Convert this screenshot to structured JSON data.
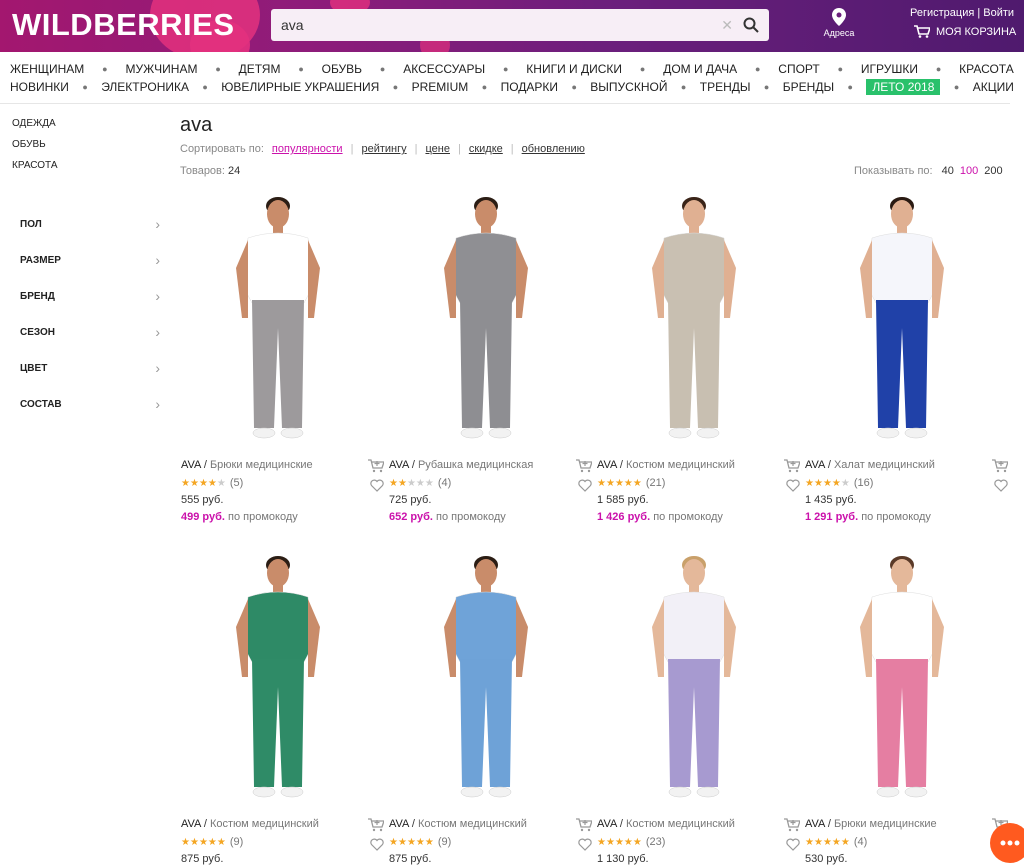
{
  "header": {
    "logo": "WILDBERRIES",
    "search_value": "ava",
    "addresses": "Адреса",
    "register": "Регистрация",
    "login": "Войти",
    "cart": "МОЯ КОРЗИНА",
    "colors": {
      "primary": "#8e1c7a",
      "accent": "#cb11ab",
      "green": "#29c16b"
    }
  },
  "nav": {
    "row1": [
      "ЖЕНЩИНАМ",
      "МУЖЧИНАМ",
      "ДЕТЯМ",
      "ОБУВЬ",
      "АКСЕССУАРЫ",
      "КНИГИ И ДИСКИ",
      "ДОМ И ДАЧА",
      "СПОРТ",
      "ИГРУШКИ",
      "КРАСОТА"
    ],
    "row2": [
      "НОВИНКИ",
      "ЭЛЕКТРОНИКА",
      "ЮВЕЛИРНЫЕ УКРАШЕНИЯ",
      "PREMIUM",
      "ПОДАРКИ",
      "ВЫПУСКНОЙ",
      "ТРЕНДЫ",
      "БРЕНДЫ",
      "ЛЕТО 2018",
      "АКЦИИ"
    ]
  },
  "sidebar": {
    "categories": [
      "ОДЕЖДА",
      "ОБУВЬ",
      "КРАСОТА"
    ],
    "filters": [
      "ПОЛ",
      "РАЗМЕР",
      "БРЕНД",
      "СЕЗОН",
      "ЦВЕТ",
      "СОСТАВ"
    ]
  },
  "main": {
    "title": "ava",
    "sort_label": "Сортировать по:",
    "sort_options": [
      "популярности",
      "рейтингу",
      "цене",
      "скидке",
      "обновлению"
    ],
    "count_label": "Товаров:",
    "count": "24",
    "perpage_label": "Показывать по:",
    "perpage_options": [
      "40",
      "100",
      "200"
    ],
    "promo_suffix": "по промокоду"
  },
  "products": [
    {
      "brand": "AVA",
      "name": "Брюки медицинские",
      "rating": 4,
      "reviews": "(5)",
      "price": "555 руб.",
      "promo": "499 руб.",
      "figure": {
        "top": "#ffffff",
        "bottom": "#9d9a9c",
        "skin": "#c98c6a",
        "hair": "#2b1d14"
      }
    },
    {
      "brand": "AVA",
      "name": "Рубашка медицинская",
      "rating": 2,
      "reviews": "(4)",
      "price": "725 руб.",
      "promo": "652 руб.",
      "figure": {
        "top": "#8f8f93",
        "bottom": "#8e8e92",
        "skin": "#c98c6a",
        "hair": "#2b1d14"
      }
    },
    {
      "brand": "AVA",
      "name": "Костюм медицинский",
      "rating": 5,
      "reviews": "(21)",
      "price": "1 585 руб.",
      "promo": "1 426 руб.",
      "figure": {
        "top": "#c9c0b2",
        "bottom": "#c8bfb1",
        "skin": "#e0b092",
        "hair": "#3a2418"
      }
    },
    {
      "brand": "AVA",
      "name": "Халат медицинский",
      "rating": 4,
      "reviews": "(16)",
      "price": "1 435 руб.",
      "promo": "1 291 руб.",
      "figure": {
        "top": "#f5f6fb",
        "bottom": "#2041a8",
        "skin": "#e0b092",
        "hair": "#2a1a12"
      }
    },
    {
      "brand": "AVA",
      "name": "Костюм медицинский",
      "rating": 5,
      "reviews": "(9)",
      "price": "875 руб.",
      "promo": "",
      "figure": {
        "top": "#2e8a66",
        "bottom": "#2f8b67",
        "skin": "#c98c6a",
        "hair": "#2b1d14"
      }
    },
    {
      "brand": "AVA",
      "name": "Костюм медицинский",
      "rating": 5,
      "reviews": "(9)",
      "price": "875 руб.",
      "promo": "",
      "figure": {
        "top": "#6fa3d8",
        "bottom": "#6ea2d7",
        "skin": "#c98c6a",
        "hair": "#2b1d14"
      }
    },
    {
      "brand": "AVA",
      "name": "Костюм медицинский",
      "rating": 5,
      "reviews": "(23)",
      "price": "1 130 руб.",
      "promo": "",
      "figure": {
        "top": "#f2f0f7",
        "bottom": "#a79ad0",
        "skin": "#e4b89a",
        "hair": "#c9a06a"
      }
    },
    {
      "brand": "AVA",
      "name": "Брюки медицинские",
      "rating": 5,
      "reviews": "(4)",
      "price": "530 руб.",
      "promo": "",
      "figure": {
        "top": "#ffffff",
        "bottom": "#e57ea2",
        "skin": "#e4b89a",
        "hair": "#5a3a28"
      }
    }
  ]
}
